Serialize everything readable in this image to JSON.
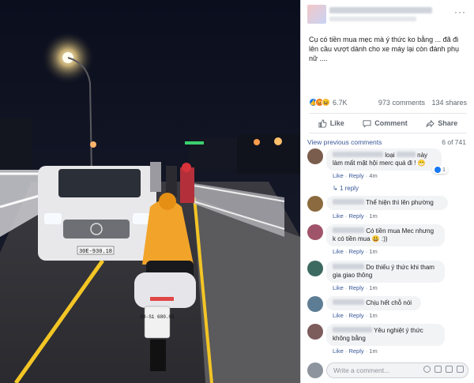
{
  "post": {
    "caption": "Cụ có tiền mua mẹc mà ý thức ko bằng ... đã đi lên cầu vượt dành cho xe máy lại còn đánh phụ nữ ....",
    "reactions_count": "6.7K",
    "comments_count": "973 comments",
    "shares_count": "134 shares",
    "more_label": "···"
  },
  "actions": {
    "like": "Like",
    "comment": "Comment",
    "share": "Share"
  },
  "comments_header": {
    "view_previous": "View previous comments",
    "count": "6 of 741"
  },
  "photo": {
    "plate_car": "30E-930.18",
    "plate_bike": "29-S1 680.05"
  },
  "comments": [
    {
      "text_a": "loại",
      "text_b": "này làm mất mặt hội merc quá đi ! 😁",
      "like": "Like",
      "reply": "Reply",
      "time": "4m",
      "likes": "1",
      "replies": "1 reply"
    },
    {
      "text": "Thể hiện thì lên phường",
      "like": "Like",
      "reply": "Reply",
      "time": "1m"
    },
    {
      "text": "Có tiền mua Mec nhưng k có tiền mua 😃 :))",
      "like": "Like",
      "reply": "Reply",
      "time": "1m"
    },
    {
      "text": "Do thiếu ý thức khi tham gia giao thông",
      "like": "Like",
      "reply": "Reply",
      "time": "1m"
    },
    {
      "text": "Chịu hết chỗ nói",
      "like": "Like",
      "reply": "Reply",
      "time": "1m"
    },
    {
      "text": "Yêu nghiệt ý thức không bằng",
      "like": "Like",
      "reply": "Reply",
      "time": "1m"
    }
  ],
  "write": {
    "placeholder": "Write a comment..."
  }
}
